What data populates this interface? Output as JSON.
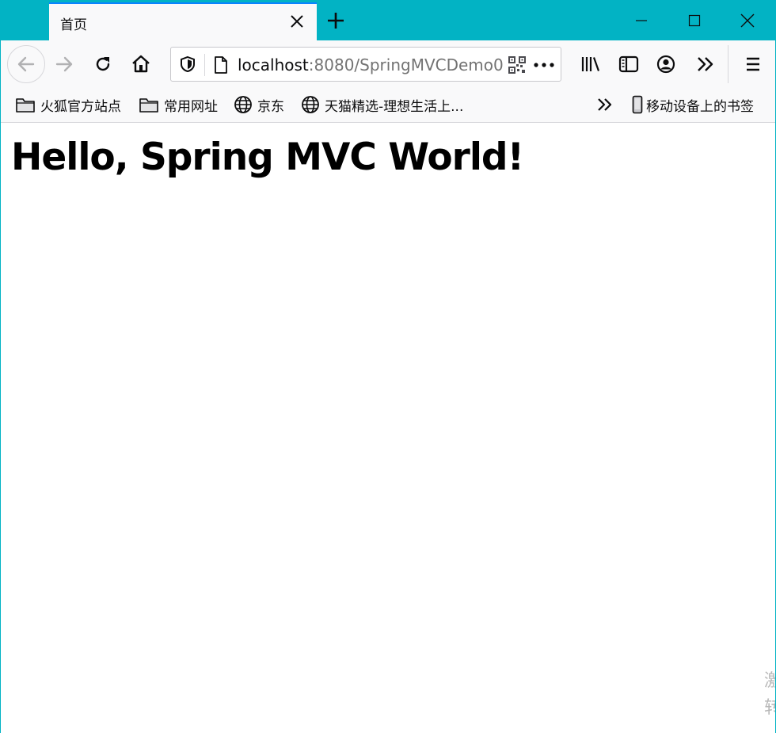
{
  "tab": {
    "title": "首页"
  },
  "url": {
    "host": "localhost",
    "rest": ":8080/SpringMVCDemo0"
  },
  "bookmarks": [
    {
      "label": "火狐官方站点",
      "icon": "folder-icon"
    },
    {
      "label": "常用网址",
      "icon": "folder-icon"
    },
    {
      "label": "京东",
      "icon": "globe-icon"
    },
    {
      "label": "天猫精选-理想生活上...",
      "icon": "globe-icon"
    }
  ],
  "mobile_bookmarks": {
    "label": "移动设备上的书签",
    "icon": "mobile-icon"
  },
  "page": {
    "heading": "Hello, Spring MVC World!"
  },
  "watermark": {
    "line1": "激",
    "line2": "转"
  },
  "colors": {
    "titlebar": "#02b3c4",
    "toolbar": "#f9f9fa",
    "tab_accent": "#0a84ff"
  }
}
